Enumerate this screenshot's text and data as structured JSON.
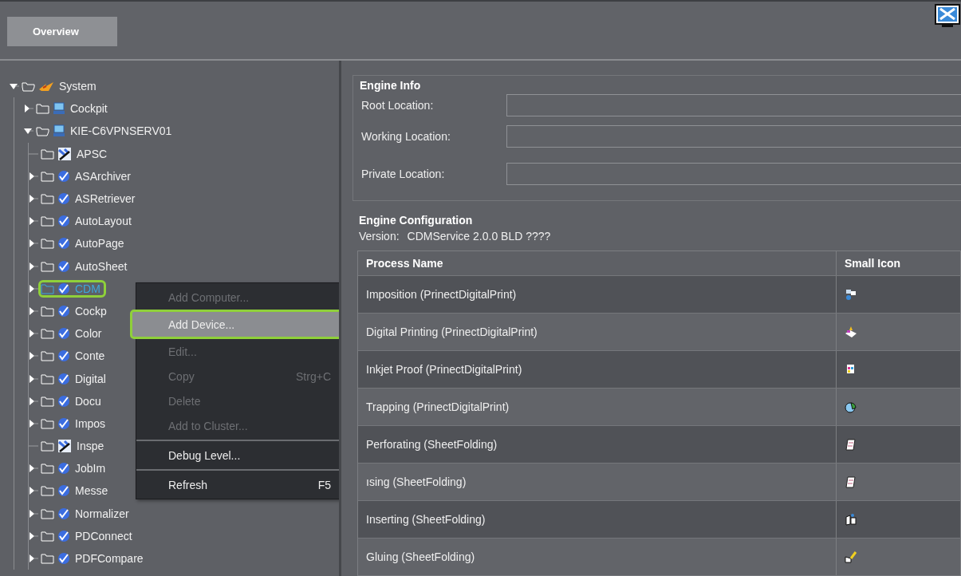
{
  "toolbar": {
    "tabs": [
      {
        "label": "Overview",
        "selected": true
      }
    ]
  },
  "tree": {
    "items": [
      {
        "label": "System",
        "kind": "system",
        "expanded": true,
        "selected": false,
        "children": [
          {
            "label": "Cockpit",
            "kind": "computer",
            "expanded": false,
            "selected": false
          },
          {
            "label": "KIE-C6VPNSERV01",
            "kind": "computer",
            "expanded": true,
            "selected": false,
            "children": [
              {
                "label": "APSC",
                "kind": "app",
                "selected": false
              },
              {
                "label": "ASArchiver",
                "kind": "service",
                "expanded": false,
                "selected": false
              },
              {
                "label": "ASRetriever",
                "kind": "service",
                "expanded": false,
                "selected": false
              },
              {
                "label": "AutoLayout",
                "kind": "service",
                "expanded": false,
                "selected": false
              },
              {
                "label": "AutoPage",
                "kind": "service",
                "expanded": false,
                "selected": false
              },
              {
                "label": "AutoSheet",
                "kind": "service",
                "expanded": false,
                "selected": false
              },
              {
                "label": "CDM",
                "kind": "service",
                "expanded": false,
                "selected": true
              },
              {
                "label": "Cockp",
                "kind": "service",
                "expanded": false,
                "selected": false
              },
              {
                "label": "Color",
                "kind": "service",
                "expanded": false,
                "selected": false
              },
              {
                "label": "Conte",
                "kind": "service",
                "expanded": false,
                "selected": false
              },
              {
                "label": "Digital",
                "kind": "service",
                "expanded": false,
                "selected": false
              },
              {
                "label": "Docu",
                "kind": "service",
                "expanded": false,
                "selected": false
              },
              {
                "label": "Impos",
                "kind": "service",
                "expanded": false,
                "selected": false
              },
              {
                "label": "Inspe",
                "kind": "app",
                "selected": false
              },
              {
                "label": "JobIm",
                "kind": "service",
                "expanded": false,
                "selected": false
              },
              {
                "label": "Messe",
                "kind": "service",
                "expanded": false,
                "selected": false
              },
              {
                "label": "Normalizer",
                "kind": "service",
                "expanded": false,
                "selected": false
              },
              {
                "label": "PDConnect",
                "kind": "service",
                "expanded": false,
                "selected": false
              },
              {
                "label": "PDFCompare",
                "kind": "service",
                "expanded": false,
                "selected": false
              }
            ]
          }
        ]
      }
    ]
  },
  "context_menu": {
    "items": [
      {
        "label": "Add Computer...",
        "disabled": true,
        "highlighted": false
      },
      {
        "label": "Add Device...",
        "disabled": false,
        "highlighted": true
      },
      {
        "label": "Edit...",
        "disabled": true,
        "highlighted": false
      },
      {
        "label": "Copy",
        "shortcut": "Strg+C",
        "disabled": true,
        "highlighted": false
      },
      {
        "label": "Delete",
        "disabled": true,
        "highlighted": false
      },
      {
        "label": "Add to Cluster...",
        "disabled": true,
        "highlighted": false
      },
      {
        "label": "Debug Level...",
        "separator_before": true,
        "disabled": false,
        "highlighted": false
      },
      {
        "label": "Refresh",
        "shortcut": "F5",
        "separator_before": true,
        "disabled": false,
        "highlighted": false
      }
    ]
  },
  "engine_info": {
    "title": "Engine Info",
    "fields": [
      {
        "label": "Root Location:"
      },
      {
        "label": "Working Location:"
      },
      {
        "label": "Private Location:"
      }
    ]
  },
  "engine_configuration": {
    "title": "Engine Configuration",
    "version_label": "Version:",
    "version": "CDMService 2.0.0 BLD ????",
    "table": {
      "columns": [
        "Process Name",
        "Small Icon"
      ],
      "rows": [
        {
          "name": "Imposition (PrinectDigitalPrint)",
          "kind": "imposition"
        },
        {
          "name": "Digital Printing (PrinectDigitalPrint)",
          "kind": "printing"
        },
        {
          "name": "Inkjet Proof (PrinectDigitalPrint)",
          "kind": "inkjet"
        },
        {
          "name": "Trapping (PrinectDigitalPrint)",
          "kind": "trapping"
        },
        {
          "name": "Perforating (SheetFolding)",
          "kind": "sheet"
        },
        {
          "name": "ısing (SheetFolding)",
          "kind": "sheet"
        },
        {
          "name": "Inserting (SheetFolding)",
          "kind": "inserting"
        },
        {
          "name": "Gluing (SheetFolding)",
          "kind": "gluing"
        }
      ]
    }
  }
}
